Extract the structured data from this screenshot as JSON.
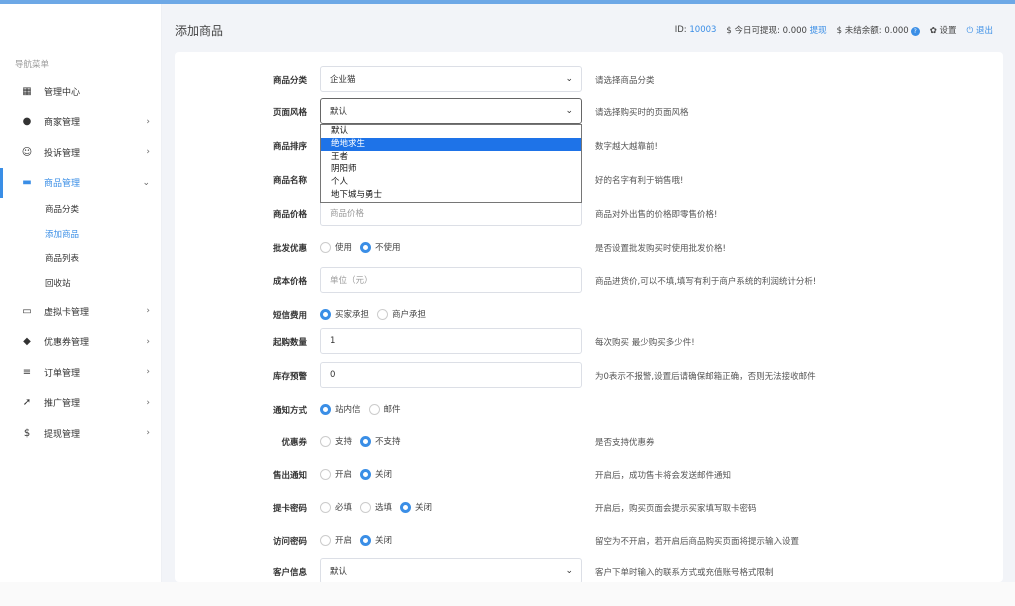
{
  "sidebar": {
    "nav_title": "导航菜单",
    "items": [
      {
        "label": "管理中心",
        "icon": "dashboard-icon",
        "glyph": "▦",
        "chevron": ""
      },
      {
        "label": "商家管理",
        "icon": "user-icon",
        "glyph": "●",
        "chevron": "›"
      },
      {
        "label": "投诉管理",
        "icon": "smile-icon",
        "glyph": "☺",
        "chevron": "›"
      },
      {
        "label": "商品管理",
        "icon": "shop-icon",
        "glyph": "▬",
        "chevron": "⌄"
      },
      {
        "label": "虚拟卡管理",
        "icon": "card-icon",
        "glyph": "▭",
        "chevron": "›"
      },
      {
        "label": "优惠券管理",
        "icon": "tag-icon",
        "glyph": "◆",
        "chevron": "›"
      },
      {
        "label": "订单管理",
        "icon": "list-icon",
        "glyph": "≡",
        "chevron": "›"
      },
      {
        "label": "推广管理",
        "icon": "send-icon",
        "glyph": "➚",
        "chevron": "›"
      },
      {
        "label": "提现管理",
        "icon": "dollar-icon",
        "glyph": "$",
        "chevron": "›"
      }
    ],
    "submenu": [
      "商品分类",
      "添加商品",
      "商品列表",
      "回收站"
    ]
  },
  "header": {
    "title": "添加商品",
    "id_label": "ID:",
    "id_value": "10003",
    "withdraw_label": "$ 今日可提现:",
    "withdraw_value": "0.000",
    "withdraw_link": "提现",
    "unsettled_label": "$ 未结余额:",
    "unsettled_value": "0.000",
    "settings": "设置",
    "logout": "退出"
  },
  "form": {
    "category": {
      "label": "商品分类",
      "value": "企业猫",
      "help": "请选择商品分类"
    },
    "style": {
      "label": "页面风格",
      "value": "默认",
      "help": "请选择购买时的页面风格"
    },
    "style_options": [
      "默认",
      "绝地求生",
      "王者",
      "阴阳师",
      "个人",
      "地下城与勇士"
    ],
    "style_highlight": "绝地求生",
    "sort": {
      "label": "商品排序",
      "help": "数字越大越靠前!"
    },
    "name": {
      "label": "商品名称",
      "help": "好的名字有利于销售哦!"
    },
    "price": {
      "label": "商品价格",
      "placeholder": "商品价格",
      "help": "商品对外出售的价格即零售价格!"
    },
    "wholesale": {
      "label": "批发优惠",
      "options": [
        "使用",
        "不使用"
      ],
      "help": "是否设置批发购买时使用批发价格!"
    },
    "cost": {
      "label": "成本价格",
      "placeholder": "单位（元）",
      "help": "商品进货价,可以不填,填写有利于商户系统的利润统计分析!"
    },
    "sms": {
      "label": "短信费用",
      "options": [
        "买家承担",
        "商户承担"
      ],
      "help": ""
    },
    "min_qty": {
      "label": "起购数量",
      "value": "1",
      "help": "每次购买 最少购买多少件!"
    },
    "stock_alert": {
      "label": "库存预警",
      "value": "0",
      "help": "为0表示不报警,设置后请确保邮箱正确，否则无法接收邮件"
    },
    "notify": {
      "label": "通知方式",
      "options": [
        "站内信",
        "邮件"
      ],
      "help": ""
    },
    "coupon": {
      "label": "优惠券",
      "options": [
        "支持",
        "不支持"
      ],
      "help": "是否支持优惠券"
    },
    "sold_notify": {
      "label": "售出通知",
      "options": [
        "开启",
        "关闭"
      ],
      "help": "开启后，成功售卡将会发送邮件通知"
    },
    "card_pwd": {
      "label": "提卡密码",
      "options": [
        "必填",
        "选填",
        "关闭"
      ],
      "help": "开启后，购买页面会提示买家填写取卡密码"
    },
    "access_pwd": {
      "label": "访问密码",
      "options": [
        "开启",
        "关闭"
      ],
      "help": "留空为不开启，若开启后商品购买页面将提示输入设置"
    },
    "customer_info": {
      "label": "客户信息",
      "value": "默认",
      "help": "客户下单时输入的联系方式或充值账号格式限制"
    }
  }
}
